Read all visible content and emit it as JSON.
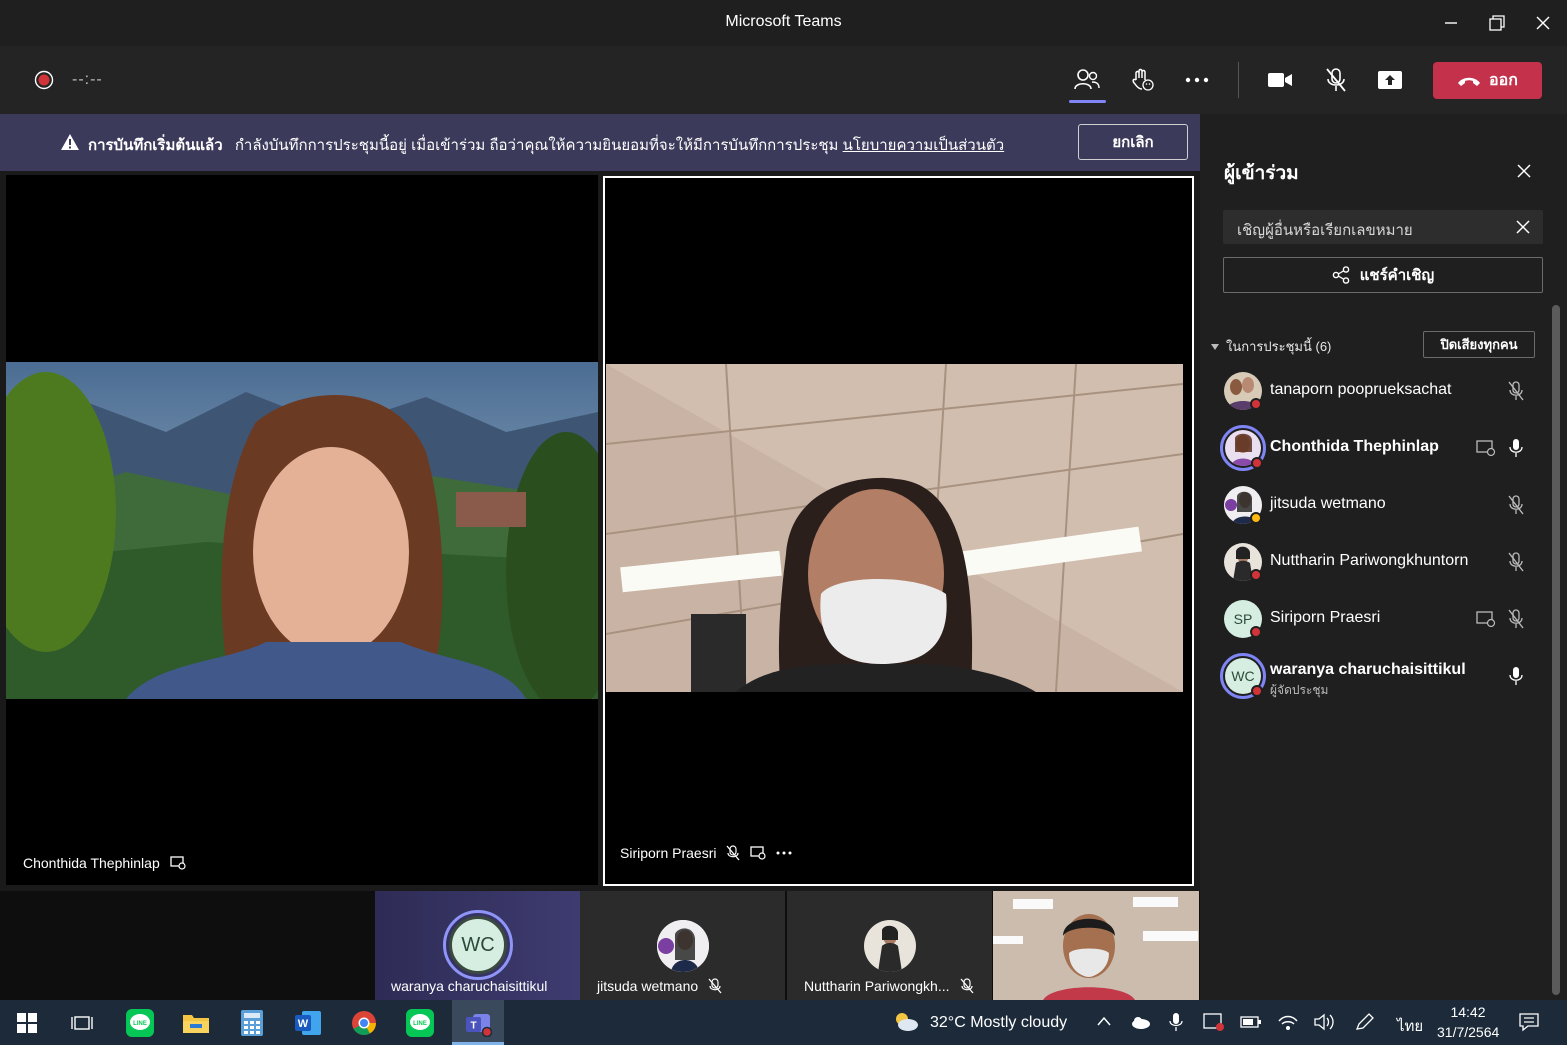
{
  "window": {
    "title": "Microsoft Teams"
  },
  "toolbar": {
    "timer": "--:--",
    "leave_label": "ออก"
  },
  "banner": {
    "bold": "การบันทึกเริ่มต้นแล้ว",
    "text": "กำลังบันทึกการประชุมนี้อยู่ เมื่อเข้าร่วม ถือว่าคุณให้ความยินยอมที่จะให้มีการบันทึกการประชุม",
    "link": "นโยบายความเป็นส่วนตัว",
    "cancel_label": "ยกเลิก"
  },
  "stage": {
    "tile1_name": "Chonthida Thephinlap",
    "tile2_name": "Siriporn Praesri"
  },
  "filmstrip": [
    {
      "initials": "WC",
      "name": "waranya charuchaisittikul"
    },
    {
      "name": "jitsuda wetmano"
    },
    {
      "name": "Nuttharin Pariwongkh..."
    }
  ],
  "panel": {
    "title": "ผู้เข้าร่วม",
    "invite_placeholder": "เชิญผู้อื่นหรือเรียกเลขหมาย",
    "share_label": "แชร์คำเชิญ",
    "section_label": "ในการประชุมนี้ (6)",
    "mute_all_label": "ปิดเสียงทุกคน",
    "participants": [
      {
        "name": "tanaporn pooprueksachat",
        "sub": ""
      },
      {
        "name": "Chonthida Thephinlap",
        "sub": ""
      },
      {
        "name": "jitsuda wetmano",
        "sub": ""
      },
      {
        "name": "Nuttharin Pariwongkhuntorn",
        "sub": ""
      },
      {
        "name": "Siriporn Praesri",
        "initials": "SP",
        "sub": ""
      },
      {
        "name": "waranya charuchaisittikul",
        "initials": "WC",
        "sub": "ผู้จัดประชุม"
      }
    ]
  },
  "taskbar": {
    "weather": "32°C  Mostly cloudy",
    "lang": "ไทย",
    "time": "14:42",
    "date": "31/7/2564"
  },
  "colors": {
    "leave": "#c4314b",
    "banner": "#3b3a5a",
    "accent": "#7f85f5",
    "taskbar": "#1c2a3a"
  }
}
